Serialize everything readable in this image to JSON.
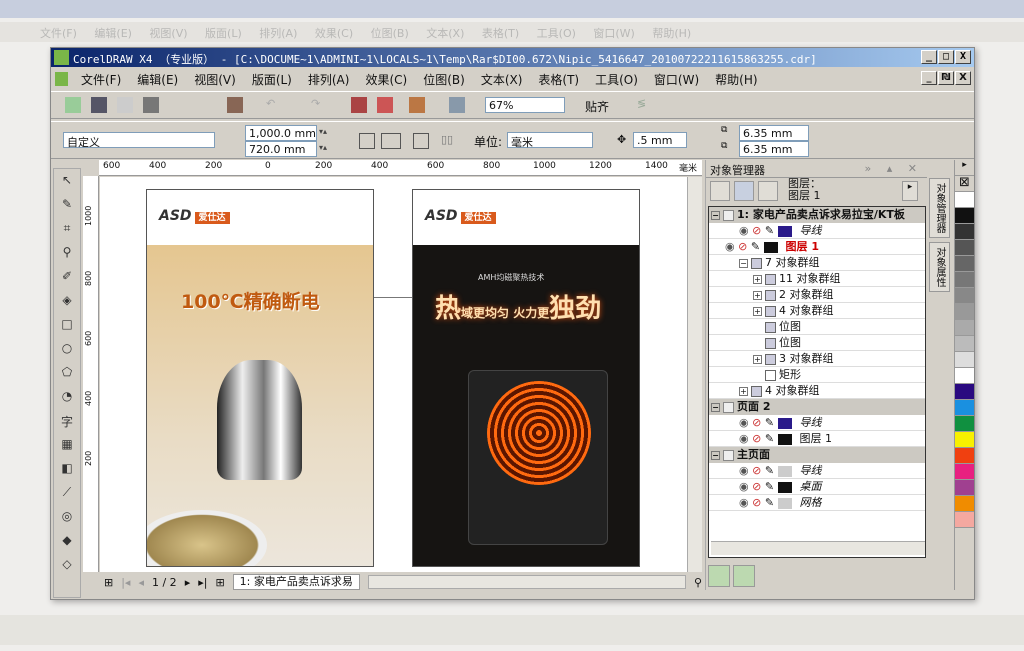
{
  "window": {
    "title": "CorelDRAW X4 （专业版） - [C:\\DOCUME~1\\ADMINI~1\\LOCALS~1\\Temp\\Rar$DI00.672\\Nipic_5416647_20100722211615863255.cdr]",
    "minimize": "_",
    "maximize": "□",
    "close": "X",
    "doc_restore": "₪"
  },
  "menu": [
    "文件(F)",
    "编辑(E)",
    "视图(V)",
    "版面(L)",
    "排列(A)",
    "效果(C)",
    "位图(B)",
    "文本(X)",
    "表格(T)",
    "工具(O)",
    "窗口(W)",
    "帮助(H)"
  ],
  "toolbar": {
    "zoom": "67%",
    "snap": "贴齐"
  },
  "propbar": {
    "page_preset": "自定义",
    "width": "1,000.0 mm",
    "height": "720.0 mm",
    "unit_label": "单位:",
    "unit": "毫米",
    "nudge": ".5 mm",
    "dup_x": "6.35 mm",
    "dup_y": "6.35 mm"
  },
  "ruler": {
    "h": [
      "600",
      "400",
      "200",
      "0",
      "200",
      "400",
      "600",
      "800",
      "1000",
      "1200",
      "1400",
      "毫米"
    ],
    "v": [
      "1000",
      "800",
      "600",
      "400",
      "200"
    ]
  },
  "pages": [
    {
      "brand": "ASD",
      "brand_cn": "爱仕达",
      "headline": "100℃精确断电"
    },
    {
      "brand": "ASD",
      "brand_cn": "爱仕达",
      "subtitle": "AMH均磁聚热技术",
      "headline_big1": "热",
      "headline_small": "域更均匀 火力更",
      "headline_big2": "独劲"
    }
  ],
  "navigator": {
    "page_count": "1 / 2",
    "page_tab": "1: 家电产品卖点诉求易"
  },
  "docker": {
    "title": "对象管理器",
    "layer_label": "图层：",
    "layer_name": "图层 1",
    "tree": [
      {
        "level": 0,
        "type": "page",
        "label": "1:  家电产品卖点诉求易拉宝/KT板"
      },
      {
        "level": 2,
        "type": "layer",
        "label": "导线",
        "color": "#2a1a8a",
        "italic": true
      },
      {
        "level": 1,
        "type": "layer",
        "label": "图层 1",
        "color": "#111111",
        "active": true
      },
      {
        "level": 2,
        "type": "group",
        "label": "7 对象群组",
        "toggle": "−"
      },
      {
        "level": 3,
        "type": "group",
        "label": "11 对象群组",
        "toggle": "+"
      },
      {
        "level": 3,
        "type": "group",
        "label": "2 对象群组",
        "toggle": "+"
      },
      {
        "level": 3,
        "type": "group",
        "label": "4 对象群组",
        "toggle": "+"
      },
      {
        "level": 3,
        "type": "bitmap",
        "label": "位图"
      },
      {
        "level": 3,
        "type": "bitmap",
        "label": "位图"
      },
      {
        "level": 3,
        "type": "group",
        "label": "3 对象群组",
        "toggle": "+"
      },
      {
        "level": 3,
        "type": "rect",
        "label": "矩形"
      },
      {
        "level": 2,
        "type": "group",
        "label": "4 对象群组",
        "toggle": "+"
      },
      {
        "level": 0,
        "type": "page",
        "label": "页面 2"
      },
      {
        "level": 2,
        "type": "layer",
        "label": "导线",
        "color": "#2a1a8a",
        "italic": true
      },
      {
        "level": 2,
        "type": "layer",
        "label": "图层 1",
        "color": "#111111"
      },
      {
        "level": 0,
        "type": "page",
        "label": "主页面"
      },
      {
        "level": 2,
        "type": "layer",
        "label": "导线",
        "color": "#cccccc",
        "italic": true
      },
      {
        "level": 2,
        "type": "layer",
        "label": "桌面",
        "color": "#111111",
        "italic": true
      },
      {
        "level": 2,
        "type": "layer",
        "label": "网格",
        "color": "#cccccc",
        "italic": true
      }
    ]
  },
  "side_tabs": [
    "对象管理器",
    "对象属性"
  ],
  "palette": [
    "#ffffff",
    "#111111",
    "#333333",
    "#555555",
    "#666666",
    "#777777",
    "#888888",
    "#999999",
    "#aaaaaa",
    "#bbbbbb",
    "#dddddd",
    "#ffffff",
    "#2a0a80",
    "#1a90e0",
    "#109040",
    "#f8f000",
    "#f04010",
    "#e82080",
    "#a04090",
    "#f08c00",
    "#f4a8a0"
  ],
  "colors": {
    "title_start": "#0a246a",
    "title_end": "#a6caf0",
    "chrome": "#d4d0c8"
  }
}
